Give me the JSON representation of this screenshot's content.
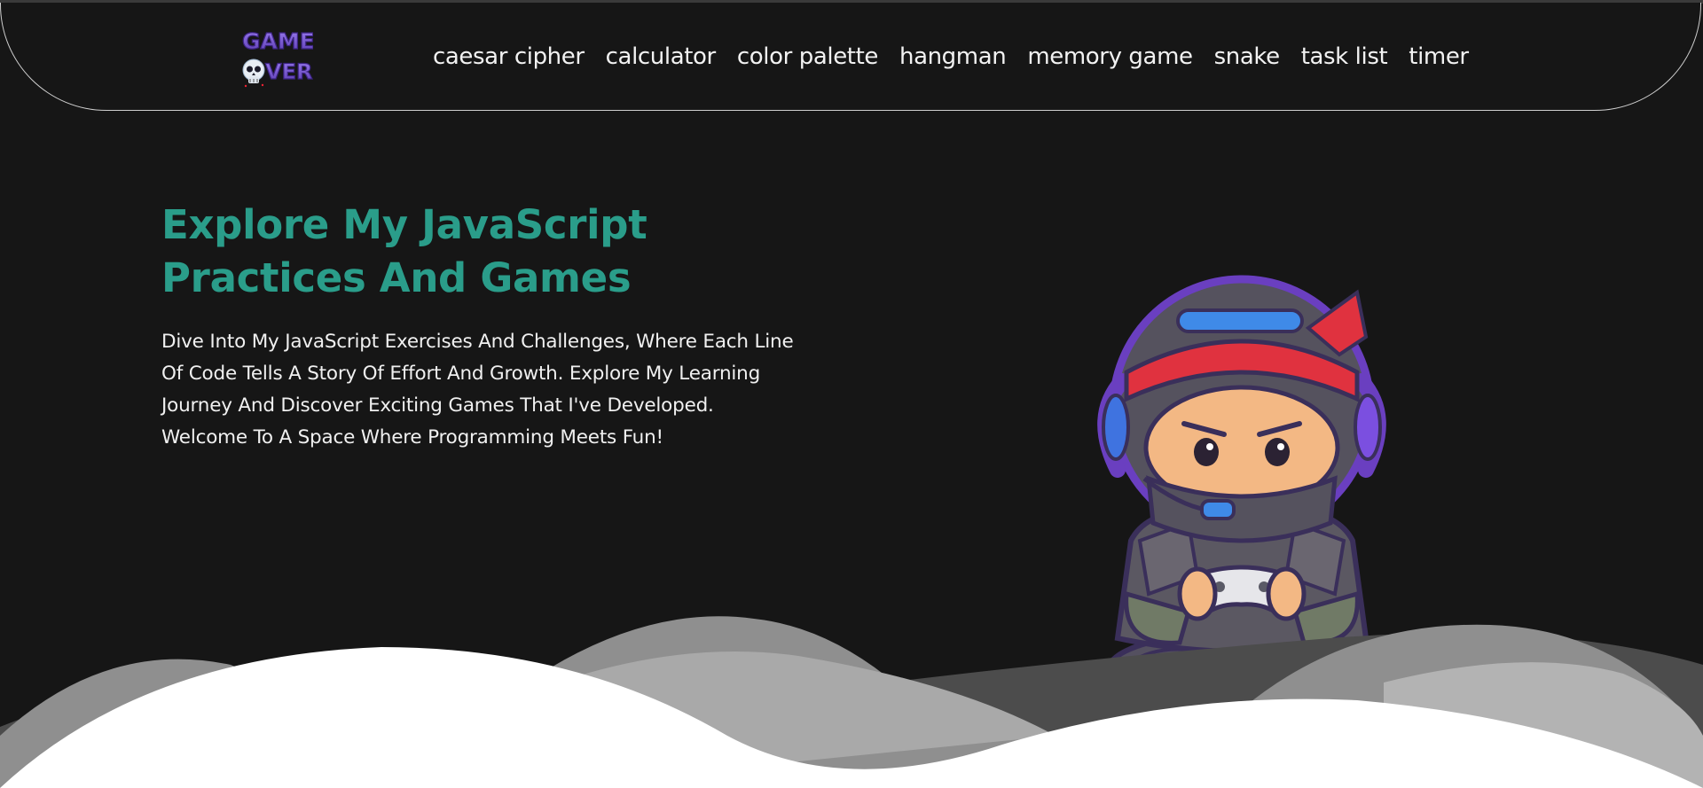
{
  "logo": {
    "line1": "GAME",
    "line2": "VER",
    "icon": "skull-icon"
  },
  "nav": {
    "links": [
      {
        "label": "caesar cipher"
      },
      {
        "label": "calculator"
      },
      {
        "label": "color palette"
      },
      {
        "label": "hangman"
      },
      {
        "label": "memory game"
      },
      {
        "label": "snake"
      },
      {
        "label": "task list"
      },
      {
        "label": "timer"
      }
    ]
  },
  "hero": {
    "title_line1": "Explore My JavaScript",
    "title_line2": "Practices And Games",
    "description": "Dive Into My JavaScript Exercises And Challenges, Where Each Line Of Code Tells A Story Of Effort And Growth. Explore My Learning Journey And Discover Exciting Games That I've Developed. Welcome To A Space Where Programming Meets Fun!"
  },
  "colors": {
    "background": "#161616",
    "accent": "#2a9d8a",
    "text": "#f0f0f0",
    "logo_purple": "#7a5ad8"
  },
  "illustration": {
    "subject": "ninja-gamer-illustration"
  }
}
